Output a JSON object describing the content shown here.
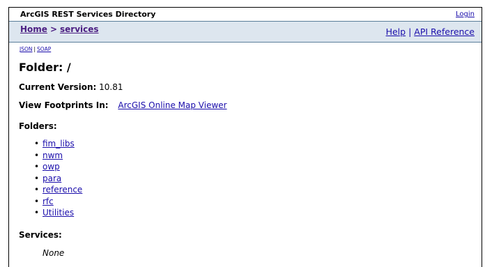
{
  "header": {
    "app_title": "ArcGIS REST Services Directory",
    "login_label": "Login"
  },
  "breadcrumb": {
    "home": "Home",
    "separator": ">",
    "current": "services"
  },
  "top_links": {
    "help": "Help",
    "separator": "|",
    "api_reference": "API Reference"
  },
  "formats": {
    "json": "JSON",
    "separator": "|",
    "soap": "SOAP"
  },
  "page": {
    "heading": "Folder: /",
    "current_version_label": "Current Version:",
    "current_version_value": "10.81",
    "view_footprints_label": "View Footprints In:",
    "view_footprints_link": "ArcGIS Online Map Viewer"
  },
  "folders": {
    "title": "Folders:",
    "items": [
      "fim_libs",
      "nwm",
      "owp",
      "para",
      "reference",
      "rfc",
      "Utilities"
    ]
  },
  "services": {
    "title": "Services:",
    "none_text": "None"
  },
  "colors": {
    "link": "#1a0dab",
    "breadcrumb_link": "#4b1e82",
    "nav_background": "#dde6ef"
  }
}
